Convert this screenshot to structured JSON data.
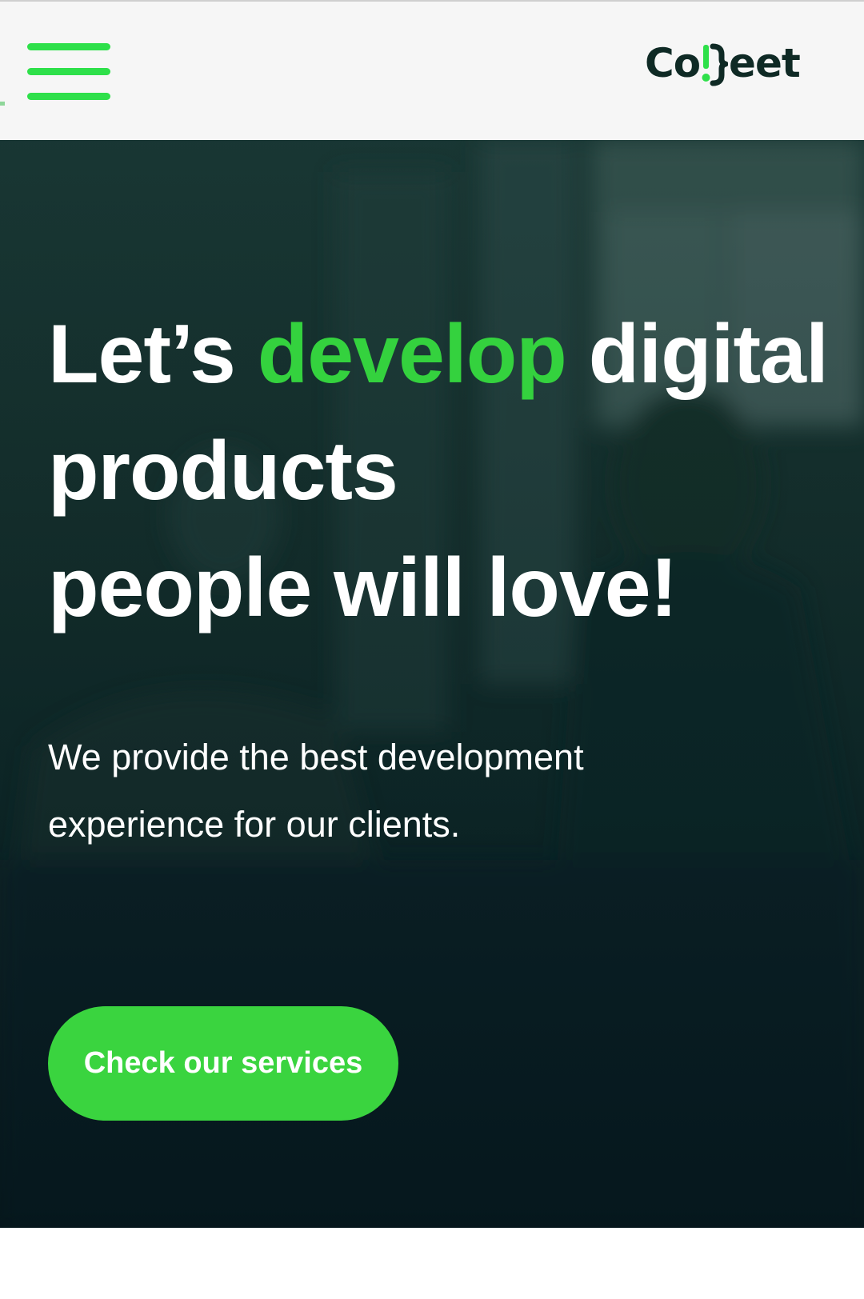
{
  "header": {
    "menu_icon": "hamburger-menu-icon",
    "logo_text_start": "Co",
    "logo_text_end": "eet",
    "logo_mark_icon": "bracket-exclamation-icon",
    "accent_color": "#2ee04a"
  },
  "hero": {
    "headline": {
      "part1": "Let’s ",
      "accent": "develop",
      "part2": " digital products",
      "line3": "people will love!"
    },
    "lead": "We provide the best development experience for our clients.",
    "cta_label": "Check our services",
    "accent_color": "#34d23e"
  }
}
